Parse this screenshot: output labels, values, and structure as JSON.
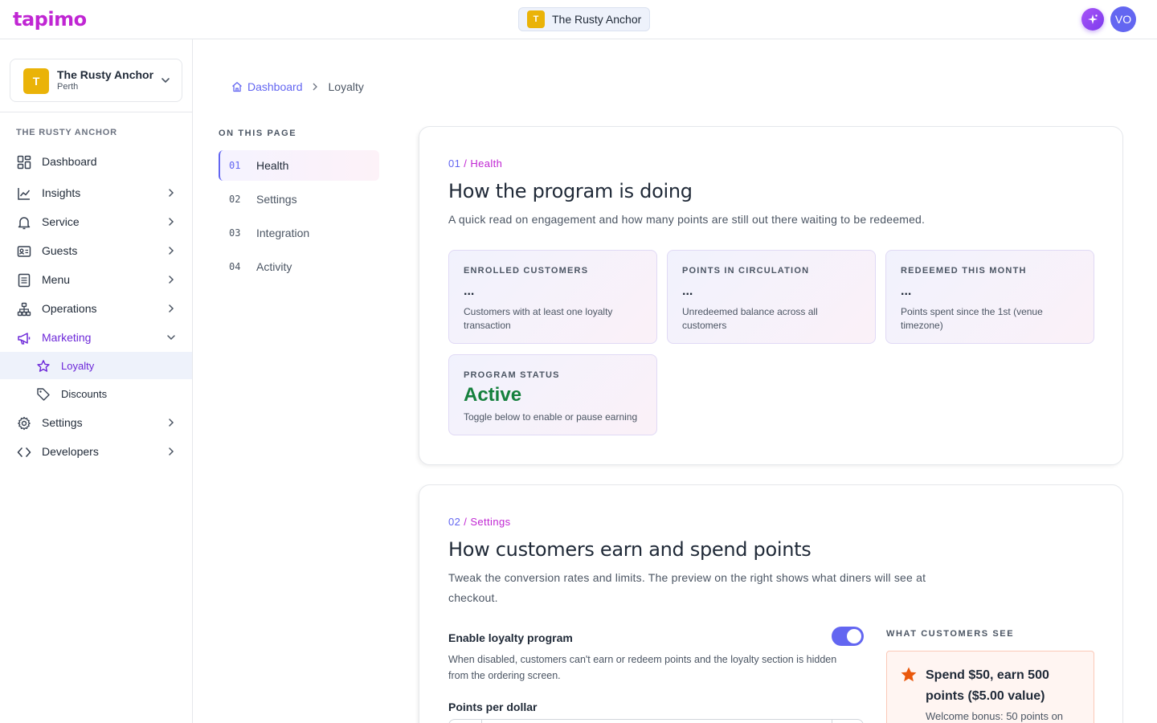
{
  "app": {
    "logo": "tapimo",
    "venue_pill": {
      "initial": "T",
      "name": "The Rusty Anchor"
    },
    "avatar_initials": "VO"
  },
  "sidebar": {
    "venue": {
      "initial": "T",
      "name": "The Rusty Anchor",
      "location": "Perth"
    },
    "heading": "THE RUSTY ANCHOR",
    "items": [
      {
        "label": "Dashboard",
        "icon": "dashboard-icon"
      },
      {
        "label": "Insights",
        "icon": "chart-icon"
      },
      {
        "label": "Service",
        "icon": "bell-icon"
      },
      {
        "label": "Guests",
        "icon": "id-card-icon"
      },
      {
        "label": "Menu",
        "icon": "menu-book-icon"
      },
      {
        "label": "Operations",
        "icon": "network-icon"
      },
      {
        "label": "Marketing",
        "icon": "megaphone-icon"
      },
      {
        "label": "Settings",
        "icon": "gear-icon"
      },
      {
        "label": "Developers",
        "icon": "code-icon"
      }
    ],
    "sub_items": [
      {
        "label": "Loyalty",
        "icon": "star-icon",
        "selected": true
      },
      {
        "label": "Discounts",
        "icon": "tag-icon",
        "selected": false
      }
    ]
  },
  "breadcrumb": {
    "home": "Dashboard",
    "current": "Loyalty"
  },
  "on_this_page": {
    "title": "ON THIS PAGE",
    "items": [
      {
        "num": "01",
        "label": "Health",
        "active": true
      },
      {
        "num": "02",
        "label": "Settings",
        "active": false
      },
      {
        "num": "03",
        "label": "Integration",
        "active": false
      },
      {
        "num": "04",
        "label": "Activity",
        "active": false
      }
    ]
  },
  "health": {
    "num": "01",
    "section": "Health",
    "title": "How the program is doing",
    "description": "A quick read on engagement and how many points are still out there waiting to be redeemed.",
    "stats": [
      {
        "label": "ENROLLED CUSTOMERS",
        "value": "...",
        "sub": "Customers with at least one loyalty transaction"
      },
      {
        "label": "POINTS IN CIRCULATION",
        "value": "...",
        "sub": "Unredeemed balance across all customers"
      },
      {
        "label": "REDEEMED THIS MONTH",
        "value": "...",
        "sub": "Points spent since the 1st (venue timezone)"
      }
    ],
    "status": {
      "label": "PROGRAM STATUS",
      "value": "Active",
      "sub": "Toggle below to enable or pause earning",
      "color": "#15803d"
    }
  },
  "settings": {
    "num": "02",
    "section": "Settings",
    "title": "How customers earn and spend points",
    "description": "Tweak the conversion rates and limits. The preview on the right shows what diners will see at checkout.",
    "enable": {
      "label": "Enable loyalty program",
      "help": "When disabled, customers can't earn or redeem points and the loyalty section is hidden from the ordering screen.",
      "on": true
    },
    "points_per_dollar_label": "Points per dollar",
    "preview": {
      "title": "WHAT CUSTOMERS SEE",
      "headline": "Spend $50, earn 500 points ($5.00 value)",
      "bonus": "Welcome bonus: 50 points on"
    }
  },
  "colors": {
    "accent": "#6366f1",
    "brand": "#c026d3",
    "active_status": "#15803d",
    "venue_badge": "#eab308"
  }
}
